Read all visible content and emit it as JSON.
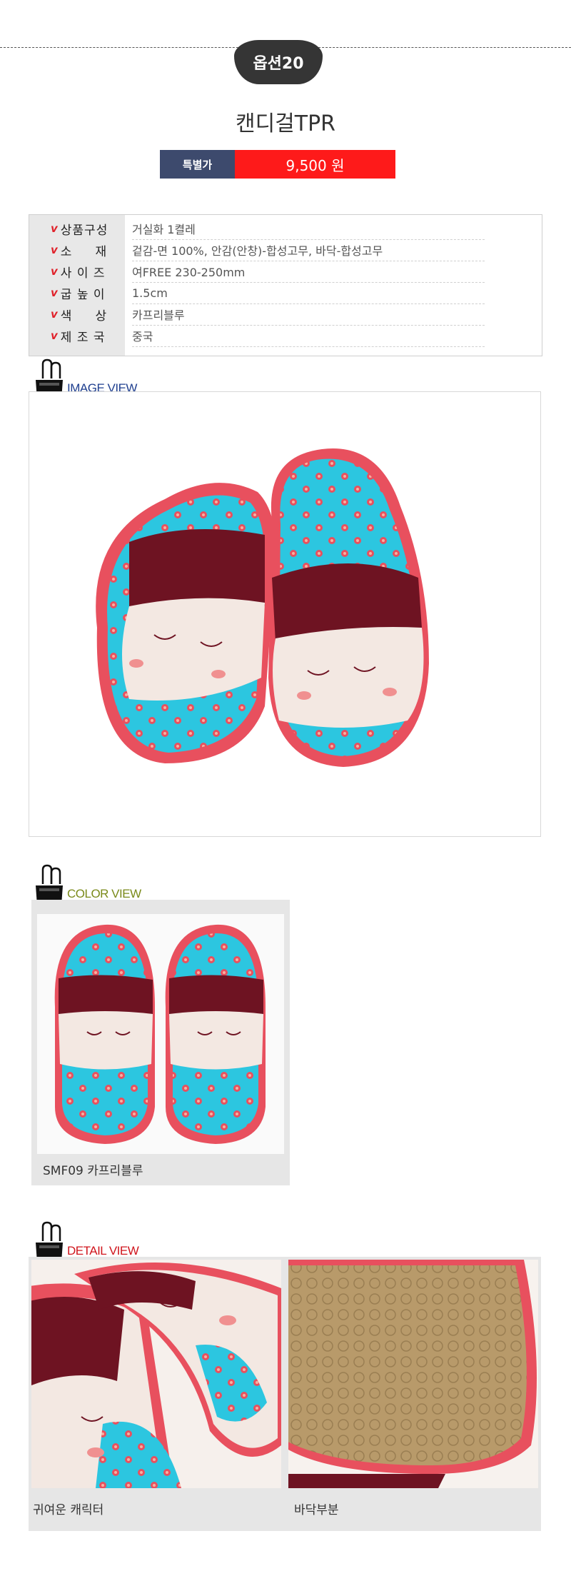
{
  "option": {
    "label": "옵션20"
  },
  "product": {
    "name": "캔디걸TPR"
  },
  "price": {
    "label": "특별가",
    "value": "9,500 원"
  },
  "specs": [
    {
      "key": "상품구성",
      "value": "거실화 1켤레"
    },
    {
      "key": "소     재",
      "value": "겉감-면 100%, 안감(안창)-합성고무, 바닥-합성고무"
    },
    {
      "key": "사 이 즈",
      "value": "여FREE 230-250mm"
    },
    {
      "key": "굽 높 이",
      "value": "1.5cm"
    },
    {
      "key": "색     상",
      "value": "카프리블루"
    },
    {
      "key": "제 조 국",
      "value": "중국"
    }
  ],
  "check_mark": "v",
  "sections": {
    "image_view": {
      "title": "IMAGE VIEW",
      "color": "#1f3f8f"
    },
    "color_view": {
      "title": "COLOR VIEW",
      "color": "#7a8a1a"
    },
    "detail_view": {
      "title": "DETAIL VIEW",
      "color": "#d0141c"
    }
  },
  "color_items": [
    {
      "caption": "SMF09 카프리블루"
    }
  ],
  "detail_items": [
    {
      "caption": "귀여운 캐릭터"
    },
    {
      "caption": "바닥부분"
    }
  ],
  "colors": {
    "price_label_bg": "#3d4a6d",
    "price_value_bg": "#fe1a1a",
    "slipper_pink": "#e8505e",
    "slipper_blue": "#2cc6e0",
    "slipper_maroon": "#6e1322",
    "slipper_cream": "#f3e8e2"
  },
  "icons": [
    "binder-clip-icon",
    "check-icon"
  ]
}
